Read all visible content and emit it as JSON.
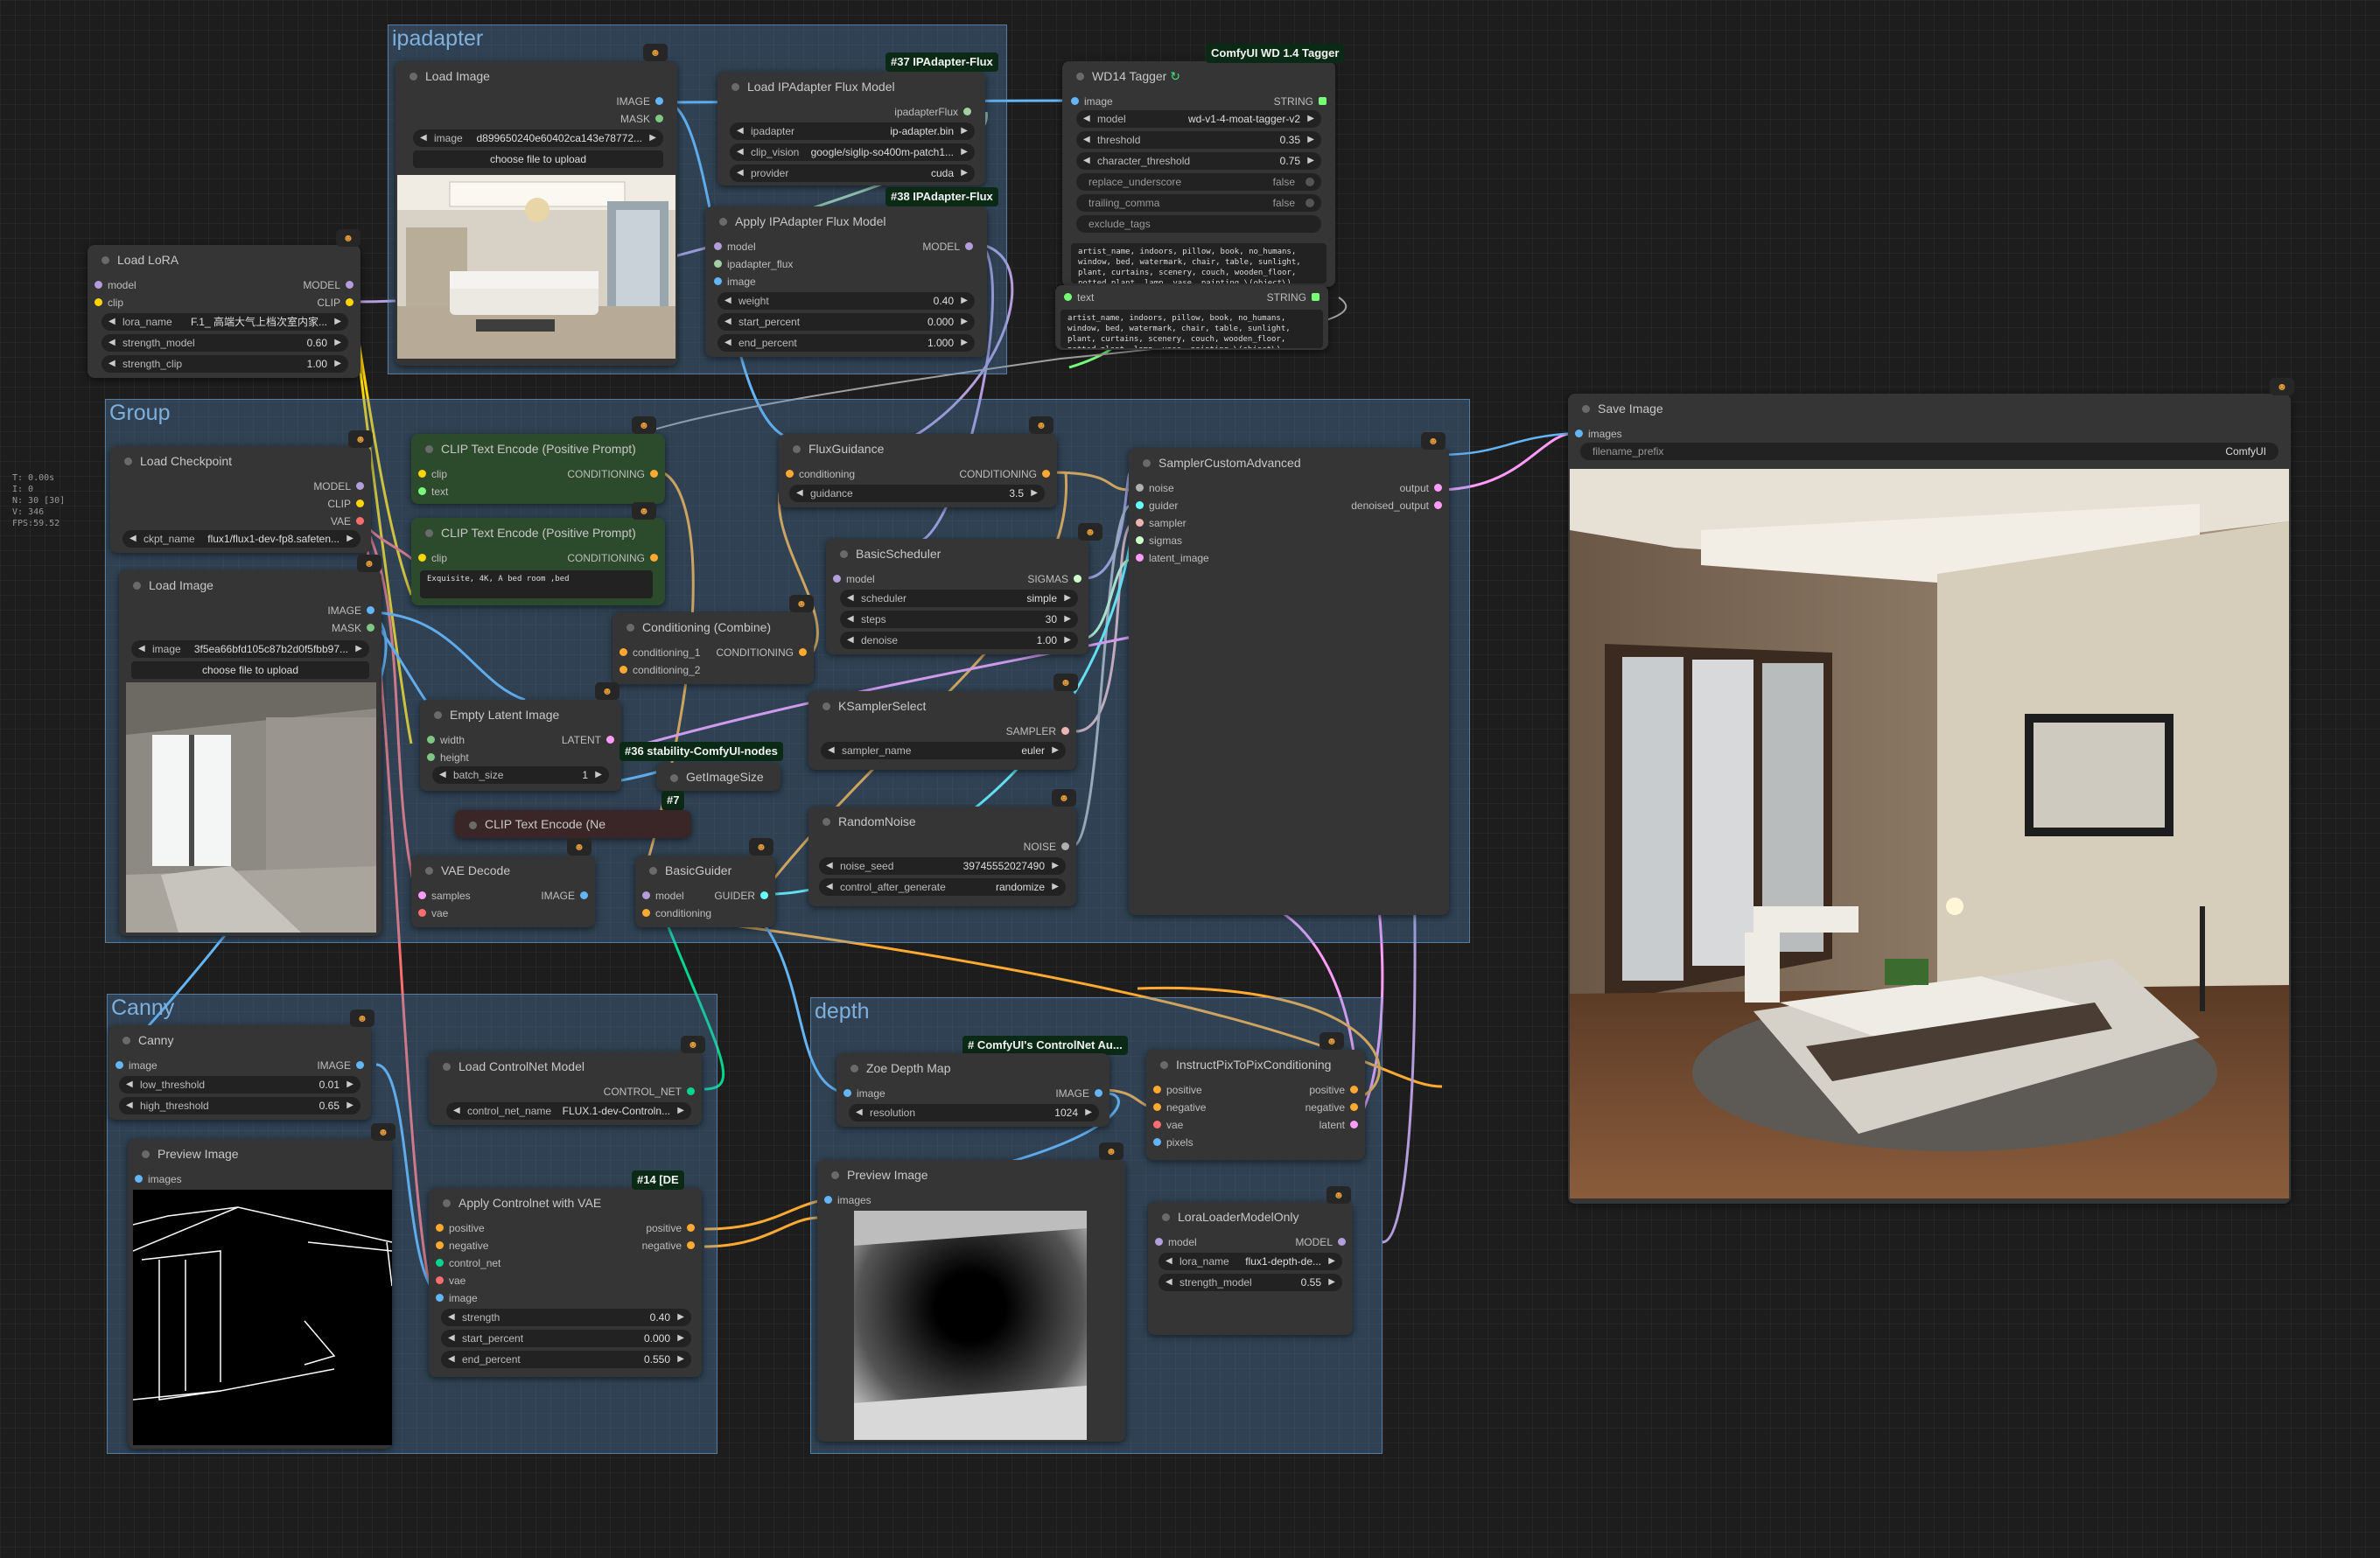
{
  "stats": [
    "T: 0.00s",
    "I: 0",
    "N: 30 [30]",
    "V: 346",
    "FPS:59.52"
  ],
  "groups": {
    "ipadapter": "ipadapter",
    "group": "Group",
    "canny": "Canny",
    "depth": "depth"
  },
  "badges": {
    "b37": "#37 IPAdapter-Flux",
    "b38": "#38 IPAdapter-Flux",
    "wd14": "ComfyUI WD 1.4 Tagger",
    "b36": "#36 stability-ComfyUI-nodes",
    "b7": "#7",
    "b14": "#14 [DE",
    "cnaux": "# ComfyUI's ControlNet Au..."
  },
  "nodes": {
    "load_image_ip": {
      "title": "Load Image",
      "out1": "IMAGE",
      "out2": "MASK",
      "image_k": "image",
      "image_v": "d899650240e60402ca143e78772...",
      "upload": "choose file to upload"
    },
    "load_ipa": {
      "title": "Load IPAdapter Flux Model",
      "out1": "ipadapterFlux",
      "w1k": "ipadapter",
      "w1v": "ip-adapter.bin",
      "w2k": "clip_vision",
      "w2v": "google/siglip-so400m-patch1...",
      "w3k": "provider",
      "w3v": "cuda"
    },
    "apply_ipa": {
      "title": "Apply IPAdapter Flux Model",
      "in1": "model",
      "in2": "ipadapter_flux",
      "in3": "image",
      "out1": "MODEL",
      "w1k": "weight",
      "w1v": "0.40",
      "w2k": "start_percent",
      "w2v": "0.000",
      "w3k": "end_percent",
      "w3v": "1.000"
    },
    "wd14": {
      "title": "WD14 Tagger",
      "in1": "image",
      "out1": "STRING",
      "w1k": "model",
      "w1v": "wd-v1-4-moat-tagger-v2",
      "w2k": "threshold",
      "w2v": "0.35",
      "w3k": "character_threshold",
      "w3v": "0.75",
      "t1k": "replace_underscore",
      "t1v": "false",
      "t2k": "trailing_comma",
      "t2v": "false",
      "ex": "exclude_tags",
      "tags": "artist_name, indoors, pillow, book, no_humans, window, bed, watermark, chair, table, sunlight, plant, curtains, scenery, couch, wooden_floor, potted_plant, lamp, vase, painting_\\(object\\), carpet, flower_pot, chandelier"
    },
    "text_node": {
      "in1": "text",
      "out1": "STRING",
      "tags": "artist_name, indoors, pillow, book, no_humans, window, bed, watermark, chair, table, sunlight, plant, curtains, scenery, couch, wooden_floor, potted_plant, lamp, vase, painting_\\(object\\), carpet, flower_pot, chandelier"
    },
    "load_lora": {
      "title": "Load LoRA",
      "in1": "model",
      "in2": "clip",
      "out1": "MODEL",
      "out2": "CLIP",
      "w1k": "lora_name",
      "w1v": "F.1_ 高端大气上档次室内家...",
      "w2k": "strength_model",
      "w2v": "0.60",
      "w3k": "strength_clip",
      "w3v": "1.00"
    },
    "load_ckpt": {
      "title": "Load Checkpoint",
      "out1": "MODEL",
      "out2": "CLIP",
      "out3": "VAE",
      "w1k": "ckpt_name",
      "w1v": "flux1/flux1-dev-fp8.safeten..."
    },
    "load_image_2": {
      "title": "Load Image",
      "out1": "IMAGE",
      "out2": "MASK",
      "image_k": "image",
      "image_v": "3f5ea66bfd105c87b2d0f5fbb97...",
      "upload": "choose file to upload"
    },
    "clip_pos1": {
      "title": "CLIP Text Encode (Positive Prompt)",
      "in1": "clip",
      "in2": "text",
      "out1": "CONDITIONING"
    },
    "clip_pos2": {
      "title": "CLIP Text Encode (Positive Prompt)",
      "in1": "clip",
      "out1": "CONDITIONING",
      "text": "Exquisite, 4K, A bed room ,bed"
    },
    "cond_combine": {
      "title": "Conditioning (Combine)",
      "in1": "conditioning_1",
      "in2": "conditioning_2",
      "out1": "CONDITIONING"
    },
    "flux_guidance": {
      "title": "FluxGuidance",
      "in1": "conditioning",
      "out1": "CONDITIONING",
      "w1k": "guidance",
      "w1v": "3.5"
    },
    "basic_sched": {
      "title": "BasicScheduler",
      "in1": "model",
      "out1": "SIGMAS",
      "w1k": "scheduler",
      "w1v": "simple",
      "w2k": "steps",
      "w2v": "30",
      "w3k": "denoise",
      "w3v": "1.00"
    },
    "sampler_adv": {
      "title": "SamplerCustomAdvanced",
      "in1": "noise",
      "in2": "guider",
      "in3": "sampler",
      "in4": "sigmas",
      "in5": "latent_image",
      "out1": "output",
      "out2": "denoised_output"
    },
    "empty_latent": {
      "title": "Empty Latent Image",
      "in1": "width",
      "in2": "height",
      "out1": "LATENT",
      "w1k": "batch_size",
      "w1v": "1"
    },
    "get_size": {
      "title": "GetImageSize"
    },
    "clip_neg": {
      "title": "CLIP Text Encode (Ne"
    },
    "ksampler_sel": {
      "title": "KSamplerSelect",
      "out1": "SAMPLER",
      "w1k": "sampler_name",
      "w1v": "euler"
    },
    "random_noise": {
      "title": "RandomNoise",
      "out1": "NOISE",
      "w1k": "noise_seed",
      "w1v": "397455520274​90",
      "w2k": "control_after_generate",
      "w2v": "randomize"
    },
    "vae_decode": {
      "title": "VAE Decode",
      "in1": "samples",
      "in2": "vae",
      "out1": "IMAGE"
    },
    "basic_guider": {
      "title": "BasicGuider",
      "in1": "model",
      "in2": "conditioning",
      "out1": "GUIDER"
    },
    "save_image": {
      "title": "Save Image",
      "in1": "images",
      "w1k": "filename_prefix",
      "w1v": "ComfyUI"
    },
    "canny": {
      "title": "Canny",
      "in1": "image",
      "out1": "IMAGE",
      "w1k": "low_threshold",
      "w1v": "0.01",
      "w2k": "high_threshold",
      "w2v": "0.65"
    },
    "preview_canny": {
      "title": "Preview Image",
      "in1": "images"
    },
    "load_cn": {
      "title": "Load ControlNet Model",
      "out1": "CONTROL_NET",
      "w1k": "control_net_name",
      "w1v": "FLUX.1-dev-Controln..."
    },
    "apply_cn": {
      "title": "Apply Controlnet with VAE",
      "in1": "positive",
      "in2": "negative",
      "in3": "control_net",
      "in4": "vae",
      "in5": "image",
      "out1": "positive",
      "out2": "negative",
      "w1k": "strength",
      "w1v": "0.40",
      "w2k": "start_percent",
      "w2v": "0.000",
      "w3k": "end_percent",
      "w3v": "0.550"
    },
    "zoe": {
      "title": "Zoe Depth Map",
      "in1": "image",
      "out1": "IMAGE",
      "w1k": "resolution",
      "w1v": "1024"
    },
    "preview_depth": {
      "title": "Preview Image",
      "in1": "images"
    },
    "ip2p": {
      "title": "InstructPixToPixConditioning",
      "in1": "positive",
      "in2": "negative",
      "in3": "vae",
      "in4": "pixels",
      "out1": "positive",
      "out2": "negative",
      "out3": "latent"
    },
    "lora_only": {
      "title": "LoraLoaderModelOnly",
      "in1": "model",
      "out1": "MODEL",
      "w1k": "lora_name",
      "w1v": "flux1-depth-de...",
      "w2k": "strength_model",
      "w2v": "0.55"
    }
  },
  "colors": {
    "image": "#64b5f6",
    "mask": "#81c784",
    "model": "#b39ddb",
    "clip": "#ffd500",
    "vae": "#ff6e6e",
    "conditioning": "#ffa931",
    "latent": "#ff9cf9",
    "noise": "#b0b0b0",
    "sigmas": "#cdffcd",
    "sampler": "#ecb4b4",
    "guider": "#66ffff",
    "string": "#77ff77",
    "ipa": "#a3cfa3",
    "cn": "#00d78d"
  }
}
